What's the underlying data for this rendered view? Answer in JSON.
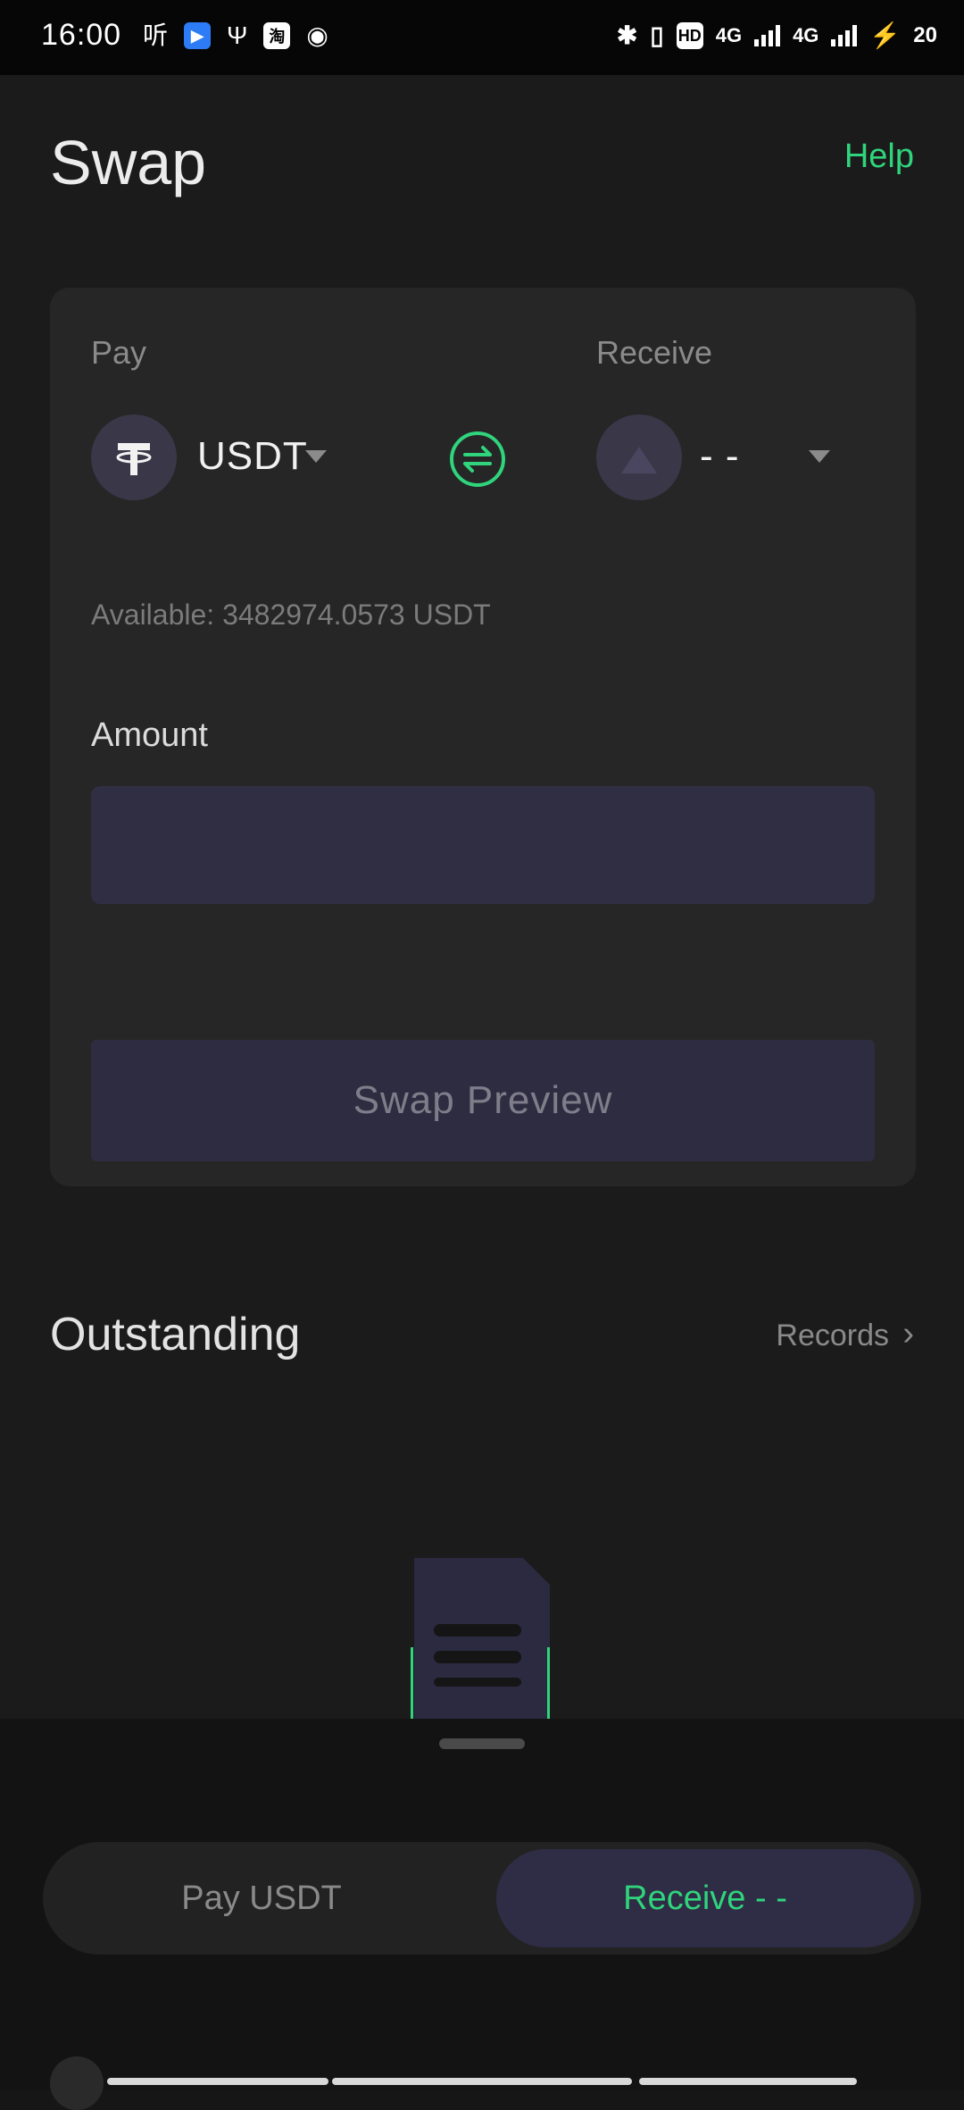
{
  "status_bar": {
    "time": "16:00",
    "left_icons": [
      "listen-icon",
      "app-icon",
      "usb-icon",
      "app-box-icon",
      "qq-icon"
    ],
    "right_icons": [
      "bluetooth-icon",
      "vibrate-icon",
      "hd-icon",
      "4g-signal-icon",
      "4g-signal-icon",
      "charging-icon"
    ],
    "network_label_1": "4G",
    "network_label_2": "4G",
    "hd_label": "HD",
    "battery": "20"
  },
  "header": {
    "title": "Swap",
    "help_label": "Help"
  },
  "swap_card": {
    "pay_label": "Pay",
    "pay_coin": "USDT",
    "receive_label": "Receive",
    "receive_coin": "- -",
    "available_text": "Available:  3482974.0573 USDT",
    "amount_label": "Amount",
    "amount_value": "",
    "preview_button": "Swap Preview"
  },
  "outstanding": {
    "title": "Outstanding",
    "records_label": "Records"
  },
  "bottom_sheet": {
    "pay_tab": "Pay USDT",
    "receive_tab": "Receive - -",
    "active_tab": "receive"
  },
  "colors": {
    "accent": "#2fd47c",
    "background": "#1b1b1b",
    "card": "#262626",
    "input": "#302e42"
  }
}
